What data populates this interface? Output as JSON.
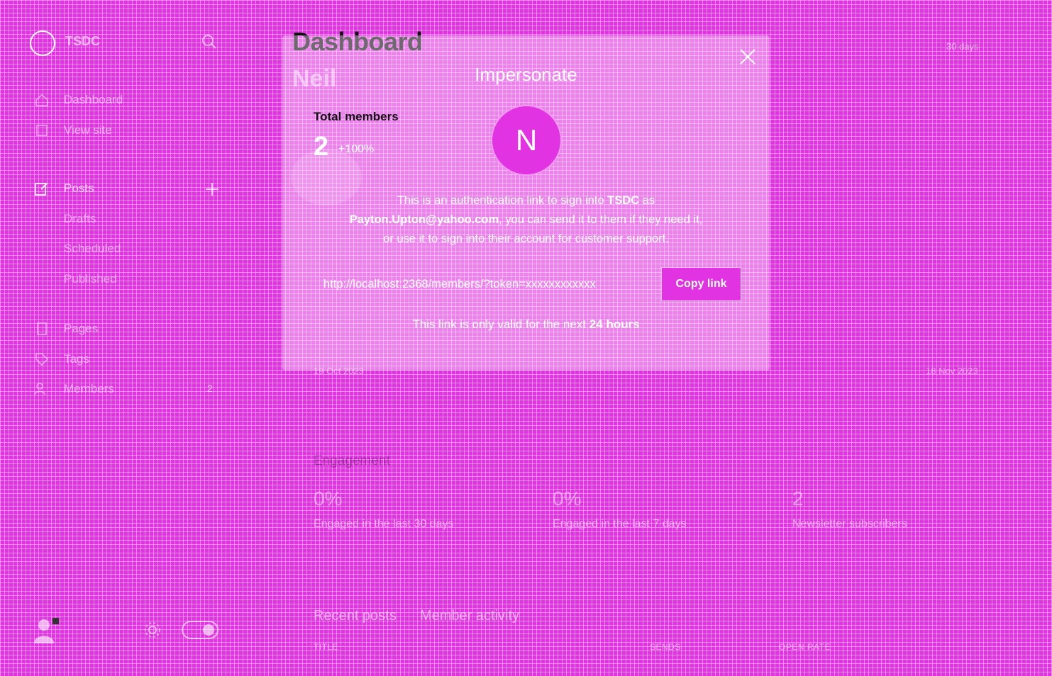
{
  "sidebar": {
    "brand": "TSDC",
    "nav": [
      {
        "label": "Dashboard",
        "icon": "home-icon"
      },
      {
        "label": "View site",
        "icon": "external-icon"
      },
      {
        "label": "Posts",
        "icon": "posts-icon"
      },
      {
        "label": "Drafts"
      },
      {
        "label": "Scheduled"
      },
      {
        "label": "Published"
      },
      {
        "label": "Pages",
        "icon": "pages-icon"
      },
      {
        "label": "Tags",
        "icon": "tag-icon"
      },
      {
        "label": "Members",
        "icon": "members-icon",
        "count": "2"
      }
    ]
  },
  "header": {
    "title": "Dashboard",
    "user_title": "Neil",
    "right_label": "30 days"
  },
  "stats": {
    "label": "Total members",
    "value": "2",
    "change": "+100%"
  },
  "chart": {
    "start_date": "19 Oct 2023",
    "end_date": "18 Nov 2023"
  },
  "modal": {
    "title": "Impersonate",
    "avatar_letter": "N",
    "desc_line1_pre": "This is an authentication link to sign into ",
    "site": "TSDC",
    "desc_line1_post": " as",
    "email": "Payton.Upton@yahoo.com",
    "desc_line2_post": ", you can send it to them if they need it,",
    "desc_line3": "or use it to sign into their account for customer support.",
    "link_value": "http://localhost:2368/members/?token=xxxxxxxxxxxx",
    "copy_label": "Copy link",
    "valid_pre": "This link is only valid for the next ",
    "valid_hours": "24 hours"
  },
  "engagement": {
    "title": "Engagement",
    "items": [
      {
        "value": "0%",
        "label": "Engaged in the last 30 days"
      },
      {
        "value": "0%",
        "label": "Engaged in the last 7 days"
      },
      {
        "value": "2",
        "label": "Newsletter subscribers"
      }
    ]
  },
  "tabs": [
    "Recent posts",
    "Member activity"
  ],
  "table_headers": [
    "TITLE",
    "SENDS",
    "OPEN RATE"
  ],
  "colors": {
    "accent": "#e233e2",
    "text_dark": "#15171a"
  }
}
